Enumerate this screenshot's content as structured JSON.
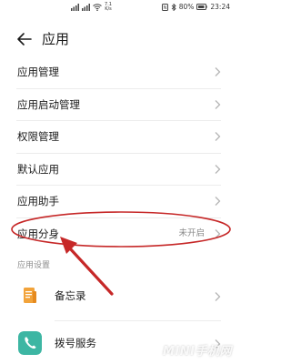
{
  "status_bar": {
    "net_speed_top": "7.1",
    "net_speed_bottom": "K/s",
    "battery": "80%",
    "time": "23:24"
  },
  "header": {
    "title": "应用"
  },
  "menu": {
    "items": [
      {
        "label": "应用管理",
        "value": ""
      },
      {
        "label": "应用启动管理",
        "value": ""
      },
      {
        "label": "权限管理",
        "value": ""
      },
      {
        "label": "默认应用",
        "value": ""
      },
      {
        "label": "应用助手",
        "value": ""
      },
      {
        "label": "应用分身",
        "value": "未开启"
      }
    ]
  },
  "section": {
    "label": "应用设置"
  },
  "apps": [
    {
      "label": "备忘录",
      "icon": "memo-icon",
      "color": "#f2a33a"
    },
    {
      "label": "拨号服务",
      "icon": "phone-icon",
      "color": "#3db6a3"
    }
  ],
  "watermark": {
    "text": "MINI手机网"
  },
  "colors": {
    "annotation_red": "#c62828",
    "chevron": "#b5b5b5"
  }
}
